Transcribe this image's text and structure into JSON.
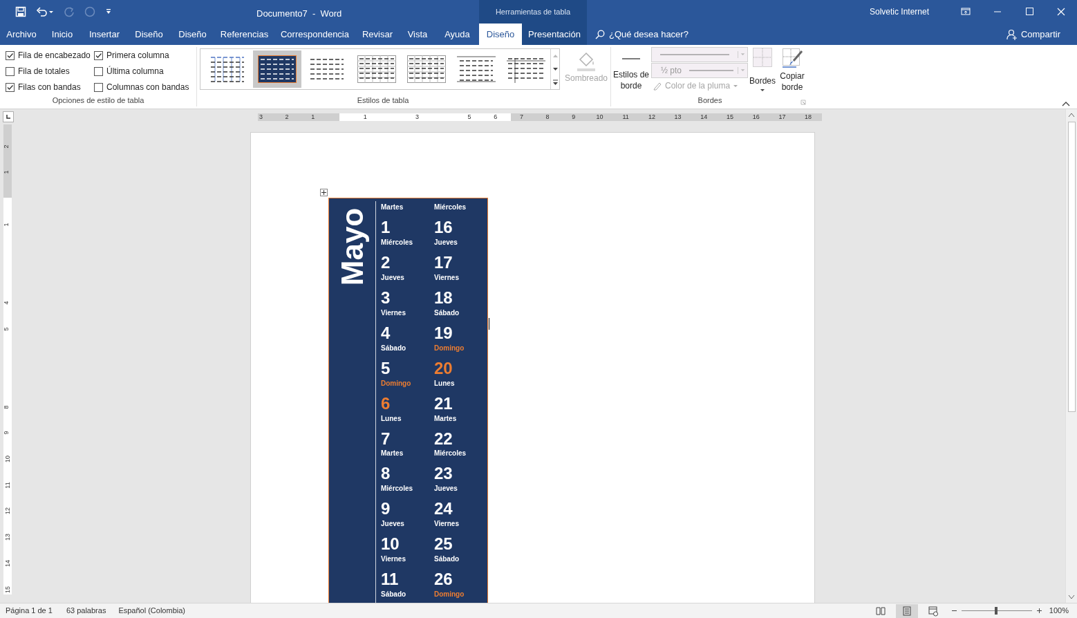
{
  "title_bar": {
    "title": "Documento7  -  Word",
    "context_label": "Herramientas de tabla",
    "user": "Solvetic Internet",
    "redo_disabled": true
  },
  "tabs": [
    {
      "label": "Archivo",
      "selected": false,
      "contextual": false
    },
    {
      "label": "Inicio",
      "selected": false,
      "contextual": false
    },
    {
      "label": "Insertar",
      "selected": false,
      "contextual": false
    },
    {
      "label": "Diseño",
      "selected": false,
      "contextual": false
    },
    {
      "label": "Diseño",
      "selected": false,
      "contextual": false
    },
    {
      "label": "Referencias",
      "selected": false,
      "contextual": false
    },
    {
      "label": "Correspondencia",
      "selected": false,
      "contextual": false
    },
    {
      "label": "Revisar",
      "selected": false,
      "contextual": false
    },
    {
      "label": "Vista",
      "selected": false,
      "contextual": false
    },
    {
      "label": "Ayuda",
      "selected": false,
      "contextual": false
    },
    {
      "label": "Diseño",
      "selected": true
    },
    {
      "label": "Presentación",
      "selected": false,
      "contextual": true
    }
  ],
  "search": {
    "placeholder": "¿Qué desea hacer?"
  },
  "share_button": "Compartir",
  "ribbon": {
    "style_options": {
      "label": "Opciones de estilo de tabla",
      "options": [
        {
          "label": "Fila de encabezado",
          "checked": true
        },
        {
          "label": "Fila de totales",
          "checked": false
        },
        {
          "label": "Filas con bandas",
          "checked": true
        },
        {
          "label": "Primera columna",
          "checked": true
        },
        {
          "label": "Última columna",
          "checked": false
        },
        {
          "label": "Columnas con bandas",
          "checked": false
        }
      ]
    },
    "table_styles": {
      "label": "Estilos de tabla",
      "styles": [
        {
          "kind": "columns",
          "selected": false
        },
        {
          "kind": "dark",
          "selected": true
        },
        {
          "kind": "plain",
          "selected": false
        },
        {
          "kind": "grid",
          "selected": false
        },
        {
          "kind": "grid",
          "selected": false
        },
        {
          "kind": "lined",
          "selected": false
        },
        {
          "kind": "first-column",
          "selected": false
        }
      ],
      "shading": {
        "label": "Sombreado",
        "disabled": true
      }
    },
    "borders": {
      "label": "Bordes",
      "border_styles": "Estilos de borde",
      "weight": "½ pto",
      "pen_color": {
        "label": "Color de la pluma",
        "disabled": true
      },
      "borders_button": "Bordes",
      "copy_border": "Copiar borde"
    }
  },
  "horizontal_ruler": [
    "3",
    "2",
    "1",
    "1",
    "3",
    "5",
    "6",
    "7",
    "8",
    "9",
    "10",
    "11",
    "12",
    "13",
    "14",
    "15",
    "16",
    "17",
    "18"
  ],
  "vertical_ruler": [
    "2",
    "1",
    "1",
    "4",
    "5",
    "8",
    "9",
    "10",
    "11",
    "12",
    "13",
    "14",
    "15"
  ],
  "calendar": {
    "month": "Mayo",
    "columns": [
      [
        {
          "day": "Martes",
          "date": "1",
          "highlighted": false
        },
        {
          "day": "Miércoles",
          "date": "2",
          "highlighted": false
        },
        {
          "day": "Jueves",
          "date": "3",
          "highlighted": false
        },
        {
          "day": "Viernes",
          "date": "4",
          "highlighted": false
        },
        {
          "day": "Sábado",
          "date": "5",
          "highlighted": false
        },
        {
          "day": "Domingo",
          "date": "6",
          "highlighted": true
        },
        {
          "day": "Lunes",
          "date": "7",
          "highlighted": false
        },
        {
          "day": "Martes",
          "date": "8",
          "highlighted": false
        },
        {
          "day": "Miércoles",
          "date": "9",
          "highlighted": false
        },
        {
          "day": "Jueves",
          "date": "10",
          "highlighted": false
        },
        {
          "day": "Viernes",
          "date": "11",
          "highlighted": false
        },
        {
          "day": "Sábado",
          "highlighted": false
        }
      ],
      [
        {
          "day": "Miércoles",
          "date": "16",
          "highlighted": false
        },
        {
          "day": "Jueves",
          "date": "17",
          "highlighted": false
        },
        {
          "day": "Viernes",
          "date": "18",
          "highlighted": false
        },
        {
          "day": "Sábado",
          "date": "19",
          "highlighted": false
        },
        {
          "day": "Domingo",
          "date": "20",
          "highlighted": true
        },
        {
          "day": "Lunes",
          "date": "21",
          "highlighted": false
        },
        {
          "day": "Martes",
          "date": "22",
          "highlighted": false
        },
        {
          "day": "Miércoles",
          "date": "23",
          "highlighted": false
        },
        {
          "day": "Jueves",
          "date": "24",
          "highlighted": false
        },
        {
          "day": "Viernes",
          "date": "25",
          "highlighted": false
        },
        {
          "day": "Sábado",
          "date": "26",
          "highlighted": false
        },
        {
          "day": "Domingo",
          "highlighted": true
        }
      ]
    ]
  },
  "status_bar": {
    "page": "Página 1 de 1",
    "words": "63 palabras",
    "language": "Español (Colombia)",
    "views": [
      {
        "kind": "read",
        "selected": false
      },
      {
        "kind": "print",
        "selected": true
      },
      {
        "kind": "web",
        "selected": false
      }
    ],
    "zoom": {
      "level": 0.5,
      "reading": "100%"
    }
  }
}
